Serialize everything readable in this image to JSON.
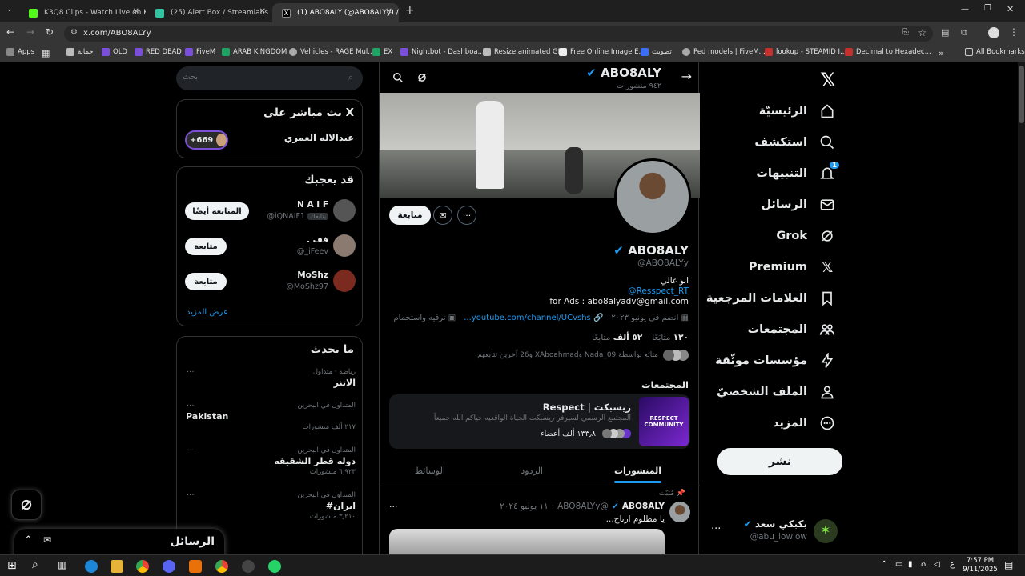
{
  "browser": {
    "tabs": [
      {
        "title": "K3Q8 Clips - Watch Live on Kick",
        "active": false
      },
      {
        "title": "(25) Alert Box / Streamlabs",
        "active": false
      },
      {
        "title": "(1) ABO8ALY (@ABO8ALYy) / X",
        "active": true
      }
    ],
    "url": "x.com/ABO8ALYy",
    "bookmarks": [
      "Apps",
      "حماية",
      "OLD",
      "RED DEAD",
      "FiveM",
      "ARAB KINGDOM",
      "Vehicles - RAGE Mul...",
      "EX",
      "Nightbot - Dashboa...",
      "Resize animated GIF",
      "Free Online Image E...",
      "تصويت",
      "Ped models | FiveM...",
      "lookup - STEAMID I...",
      "Decimal to Hexadec..."
    ],
    "all_bookmarks": "All Bookmarks",
    "colors": {
      "tab_bar": "#1f1f1f",
      "toolbar": "#353535"
    }
  },
  "nav": {
    "items": [
      "الرئيسيّة",
      "استكشف",
      "التنبيهات",
      "الرسائل",
      "Grok",
      "Premium",
      "العلامات المرجعية",
      "المجتمعات",
      "مؤسسات موثّقة",
      "الملف الشخصيّ",
      "المزيد"
    ],
    "notification_count": "1",
    "post_button": "نشر",
    "account": {
      "name": "بكبكي سعد",
      "handle": "@abu_lowlow",
      "more": "..."
    }
  },
  "profile": {
    "header_name": "ABO8ALY",
    "header_posts": "٩٤٢ منشورات",
    "name": "ABO8ALY",
    "handle": "@ABO8ALYy",
    "bio_line1": "ابو غالي",
    "bio_line2": "@Resspect_RT",
    "bio_line3": "for Ads : abo8alyadv@gmail.com",
    "category": "ترفيه واستجمام",
    "link": "youtube.com/channel/UCvshs...",
    "joined": "انضم في يونيو ٢٠٢٣",
    "following_count": "١٢٠",
    "following_label": "متابَعًا",
    "followers_count": "٥٢ ألف",
    "followers_label": "متابِعًا",
    "followed_by": "متابَع بواسطة Nada_09 وXAboahmad و26 آخرين تتابعهم",
    "follow_button": "متابعة",
    "verified_color": "#1d9bf0"
  },
  "communities": {
    "title": "المجتمعات",
    "name": "Respect | ريسبكت",
    "desc": "المجتمع الرسمي لسيرفر ريسبكت الحياة الواقعيه حياكم الله جميعاً",
    "members": "١٣٣٫٨ ألف أعضاء",
    "badge": "RESPECT COMMUNITY"
  },
  "tabs": [
    "المنشورات",
    "الردود",
    "الوسائط"
  ],
  "post": {
    "pinned": "مُثبّت",
    "author": "ABO8ALY",
    "handle": "@ABO8ALYy",
    "date": "١١ يوليو ٢٠٢٤",
    "text": "يا مظلوم ارتاح...",
    "more": "..."
  },
  "sidebar": {
    "search_placeholder": "بحث",
    "live": {
      "title": "X بث مباشر على",
      "host": "عبدالاله العمري",
      "count": "+669"
    },
    "who_to_follow": {
      "title": "قد يعجبك",
      "users": [
        {
          "name": "N A I F",
          "handle": "@iQNAIF1",
          "badge": "يتابعك",
          "button": "المتابعة أيضًا"
        },
        {
          "name": "فف .",
          "handle": "@_iFeev",
          "button": "متابعة"
        },
        {
          "name": "MoShz",
          "handle": "@MoShz97",
          "button": "متابعة"
        }
      ],
      "show_more": "عرض المزيد"
    },
    "trends": {
      "title": "ما يحدث",
      "items": [
        {
          "context": "رياضة · متداول",
          "name": "الاتنر",
          "count": ""
        },
        {
          "context": "المتداول في البحرين",
          "name": "Pakistan",
          "count": "٢١٧ ألف منشورات"
        },
        {
          "context": "المتداول في البحرين",
          "name": "دوله قطر الشقيقه",
          "count": "٦٫٩٢٣ منشورات"
        },
        {
          "context": "المتداول في البحرين",
          "name": "#ايران",
          "count": "٣٫٢١٠ منشورات"
        }
      ]
    }
  },
  "messages_drawer": {
    "title": "الرسائل"
  },
  "taskbar": {
    "time": "7:57 PM",
    "date": "9/11/2025",
    "lang": "ع"
  }
}
